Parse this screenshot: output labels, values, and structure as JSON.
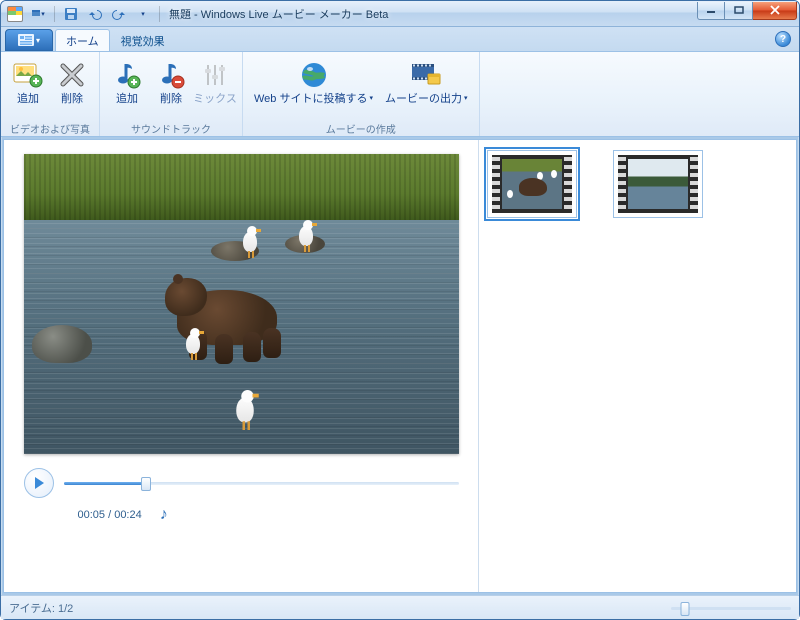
{
  "window": {
    "title": "無題 - Windows Live ムービー メーカー Beta"
  },
  "qat": {
    "save": "save-icon",
    "undo": "undo-icon",
    "redo": "redo-icon"
  },
  "tabs": {
    "home": "ホーム",
    "visual_effects": "視覚効果"
  },
  "ribbon": {
    "group_media": {
      "label": "ビデオおよび写真",
      "add": "追加",
      "remove": "削除"
    },
    "group_sound": {
      "label": "サウンドトラック",
      "add": "追加",
      "remove": "削除",
      "mix": "ミックス"
    },
    "group_make": {
      "label": "ムービーの作成",
      "publish": "Web サイトに投稿する",
      "output": "ムービーの出力"
    }
  },
  "player": {
    "time": "00:05 / 00:24",
    "progress_pct": 21
  },
  "storyboard": {
    "selected_index": 0,
    "clips": [
      "clip-1",
      "clip-2"
    ]
  },
  "status": {
    "items": "アイテム: 1/2",
    "zoom_pct": 12
  },
  "colors": {
    "accent": "#3a8ad8",
    "ribbon_text": "#15428b"
  }
}
